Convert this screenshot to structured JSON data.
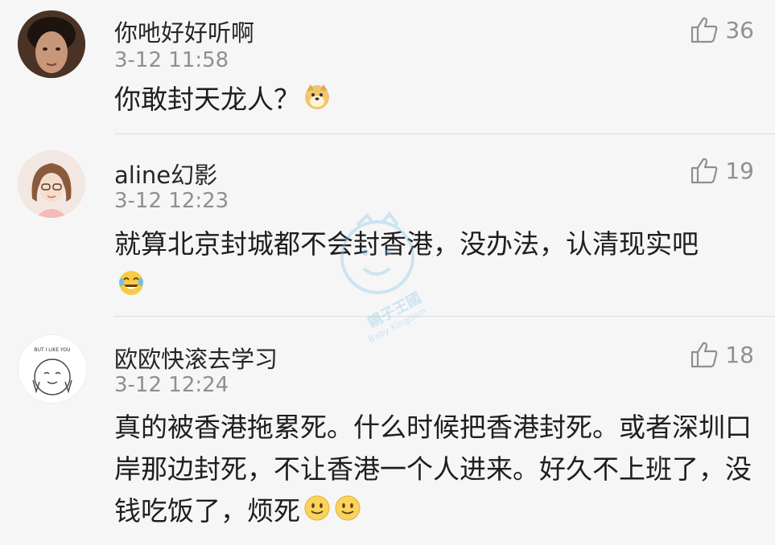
{
  "comments": [
    {
      "username": "你吔好好听啊",
      "time": "3-12 11:58",
      "likes": "36",
      "text": "你敢封天龙人？",
      "emoji": "doge-emoji"
    },
    {
      "username": "aline幻影",
      "time": "3-12 12:23",
      "likes": "19",
      "text": "就算北京封城都不会封香港，没办法，认清现实吧",
      "emoji": "laugh-tears-emoji"
    },
    {
      "username": "欧欧快滚去学习",
      "time": "3-12 12:24",
      "likes": "18",
      "text": "真的被香港拖累死。什么时候把香港封死。或者深圳口岸那边封死，不让香港一个人进来。好久不上班了，没钱吃饭了，烦死",
      "emoji": "smile-emoji",
      "avatar_text": "BUT I LIKE YOU"
    }
  ],
  "watermark": {
    "line1": "親子王國",
    "line2": "Baby Kingdom"
  },
  "colors": {
    "background": "#f6f6f6",
    "meta_text": "#8f8f8f",
    "divider": "#dcdcdc",
    "watermark": "#7fc4e8"
  }
}
